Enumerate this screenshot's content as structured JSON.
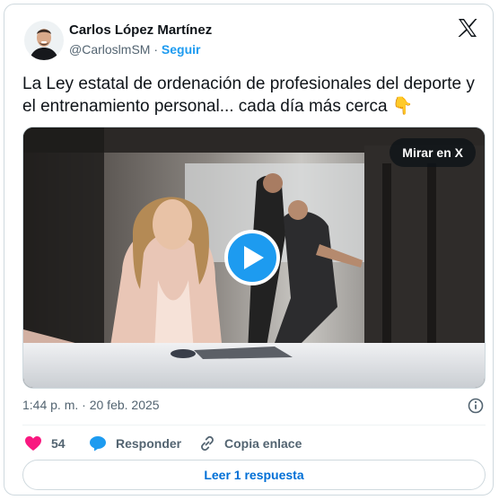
{
  "author": {
    "name": "Carlos López Martínez",
    "handle": "@CarloslmSM",
    "separator": "·",
    "follow_label": "Seguir"
  },
  "tweet": {
    "text": "La Ley estatal de ordenación de profesionales del deporte y el entrenamiento personal... cada día más cerca 👇"
  },
  "media": {
    "watch_label": "Mirar en X",
    "play_icon": "play-icon"
  },
  "meta": {
    "time": "1:44 p. m.",
    "separator": "·",
    "date": "20 feb. 2025",
    "info_icon": "info-icon"
  },
  "actions": {
    "likes_count": "54",
    "reply_label": "Responder",
    "copy_label": "Copia enlace"
  },
  "read_replies_label": "Leer 1 respuesta",
  "colors": {
    "accent": "#1d9bf0",
    "like": "#f91880",
    "text": "#0f1419",
    "muted": "#536471"
  }
}
